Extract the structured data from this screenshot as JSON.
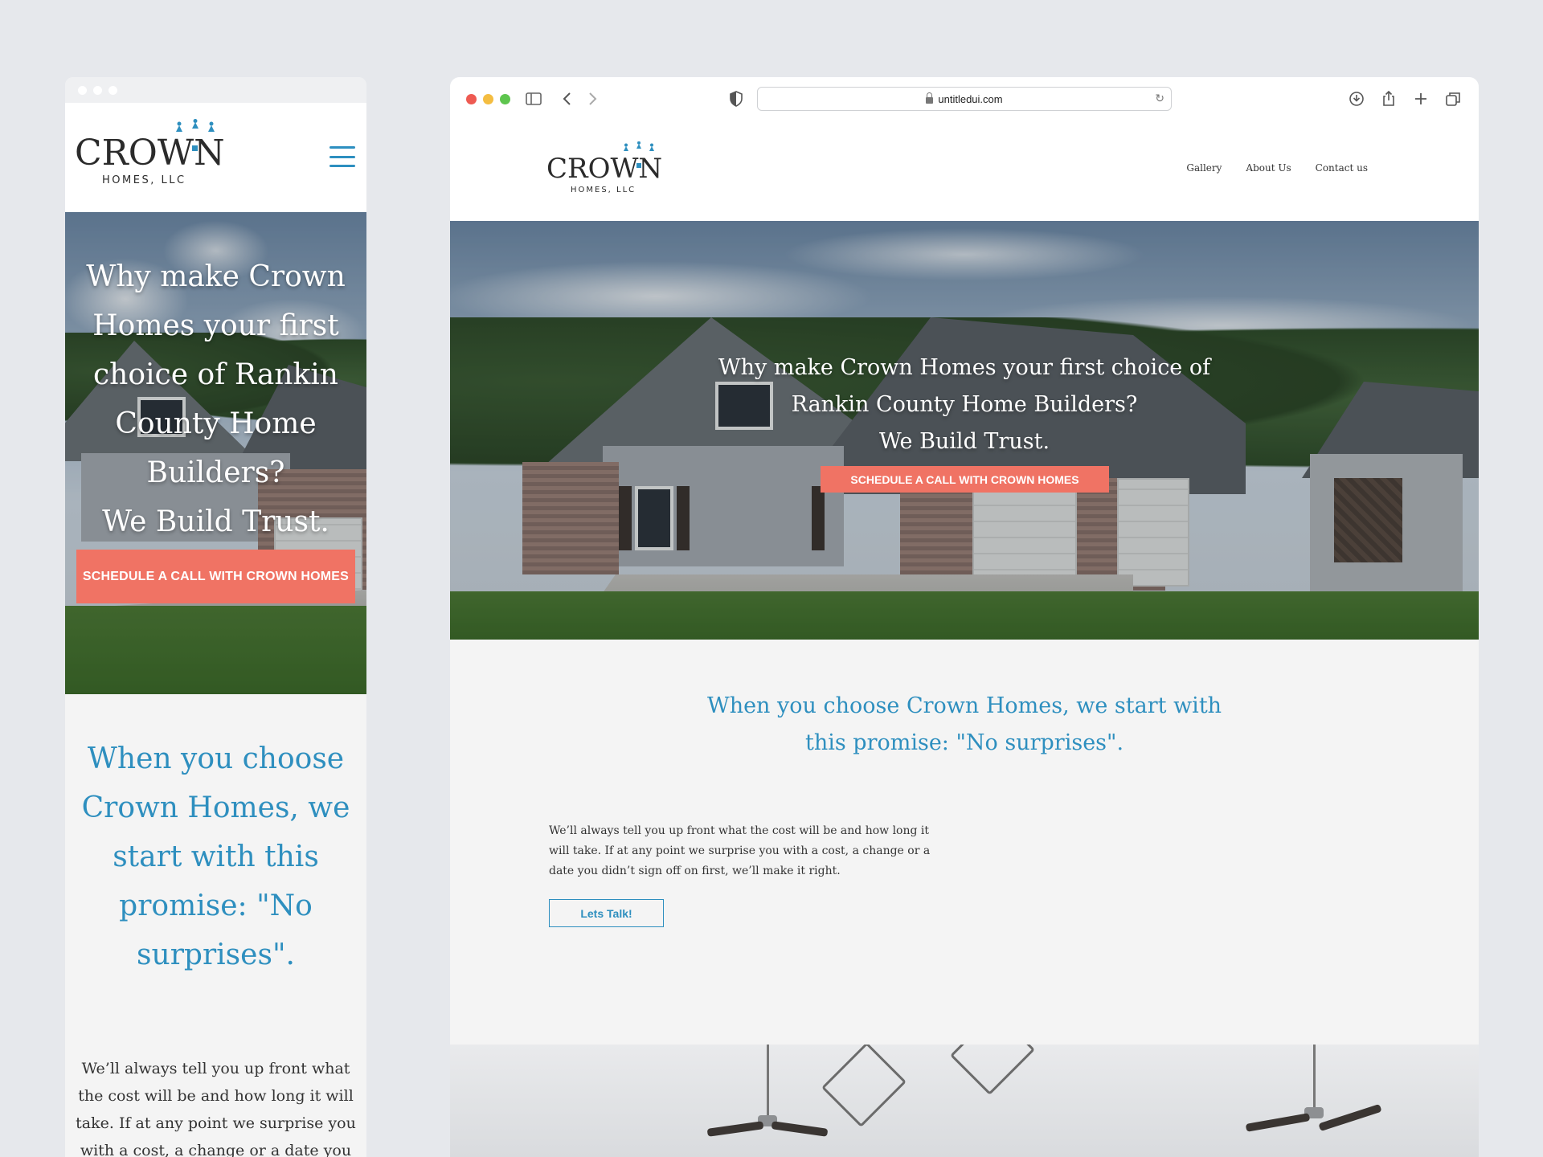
{
  "mobile": {
    "logo": {
      "brand": "CROWN",
      "sub": "HOMES, LLC"
    },
    "hero": {
      "headline": "Why make Crown Homes your first choice of Rankin County Home Builders?",
      "tagline": "We Build Trust.",
      "cta": "SCHEDULE A CALL WITH CROWN HOMES"
    },
    "promise": "When you choose Crown Homes, we start with this promise: \"No surprises\".",
    "body": "We’ll always tell you up front what the cost will be and how long it will take. If at any point we surprise you with a cost, a change or a date you"
  },
  "browser": {
    "url": "untitledui.com",
    "icons": [
      "sidebar-icon",
      "back-icon",
      "forward-icon",
      "shield-icon",
      "download-icon",
      "share-icon",
      "new-tab-icon",
      "tabs-icon"
    ]
  },
  "desktop": {
    "logo": {
      "brand": "CROWN",
      "sub": "HOMES, LLC"
    },
    "nav": [
      "Gallery",
      "About Us",
      "Contact us"
    ],
    "hero": {
      "headline_line1": "Why make Crown Homes your first choice of",
      "headline_line2": "Rankin County Home Builders?",
      "tagline": "We Build Trust.",
      "cta": "SCHEDULE A CALL WITH CROWN HOMES"
    },
    "promise_line1": "When you choose Crown Homes, we start with",
    "promise_line2": "this promise: \"No surprises\".",
    "body": "We’ll always tell you up front what the cost will be and how long it will take. If at any point we surprise you with a cost, a change or a date you didn’t sign off on first, we’ll make it right.",
    "talk_button": "Lets Talk!"
  },
  "colors": {
    "accent_blue": "#2e8fbf",
    "cta_coral": "#f07364",
    "logo_dark": "#2b2b2b"
  }
}
